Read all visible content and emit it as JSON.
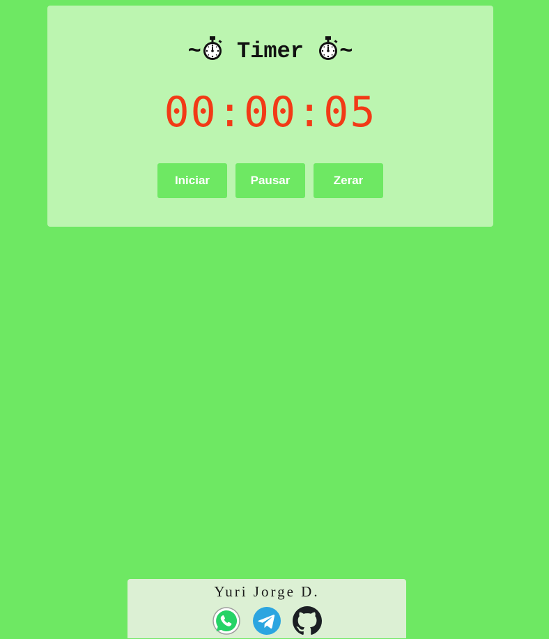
{
  "timer": {
    "title_prefix": "~",
    "title_text": " Timer ",
    "title_suffix": "~",
    "title_icon": "stopwatch-icon",
    "display": "00:00:05",
    "display_color": "#f23a16"
  },
  "controls": {
    "start_label": "Iniciar",
    "pause_label": "Pausar",
    "reset_label": "Zerar"
  },
  "footer": {
    "author": "Yuri Jorge D.",
    "links": [
      {
        "icon": "whatsapp-icon",
        "color": "#25d366"
      },
      {
        "icon": "telegram-icon",
        "color": "#2ca5e0"
      },
      {
        "icon": "github-icon",
        "color": "#1b1f23"
      }
    ]
  },
  "colors": {
    "background": "#6ee863",
    "card": "#bcf5b0",
    "button": "#6ee863",
    "footer": "#dcf0d4"
  }
}
